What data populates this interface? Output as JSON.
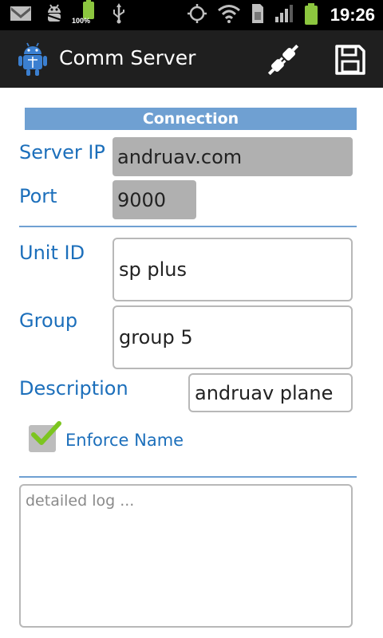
{
  "status_bar": {
    "icons": [
      "gmail-icon",
      "android-debug-icon",
      "battery-charging-icon",
      "usb-icon",
      "gps-icon",
      "wifi-icon",
      "sim-icon",
      "signal-icon",
      "battery-icon"
    ],
    "battery_percent": "100%",
    "time": "19:26"
  },
  "action_bar": {
    "title": "Comm Server",
    "actions": [
      "plug-icon",
      "save-icon"
    ]
  },
  "form": {
    "section_title": "Connection",
    "server_ip": {
      "label": "Server IP",
      "value": "andruav.com"
    },
    "port": {
      "label": "Port",
      "value": "9000"
    },
    "unit_id": {
      "label": "Unit ID",
      "value": "sp plus"
    },
    "group": {
      "label": "Group",
      "value": "group 5"
    },
    "description": {
      "label": "Description",
      "value": "andruav plane"
    },
    "enforce_name": {
      "label": "Enforce Name",
      "checked": true
    },
    "log": {
      "placeholder": "detailed log ..."
    }
  },
  "colors": {
    "accent": "#6fa0d2",
    "label": "#1c6fbb",
    "battery": "#8cc63f",
    "check": "#7cc520"
  }
}
